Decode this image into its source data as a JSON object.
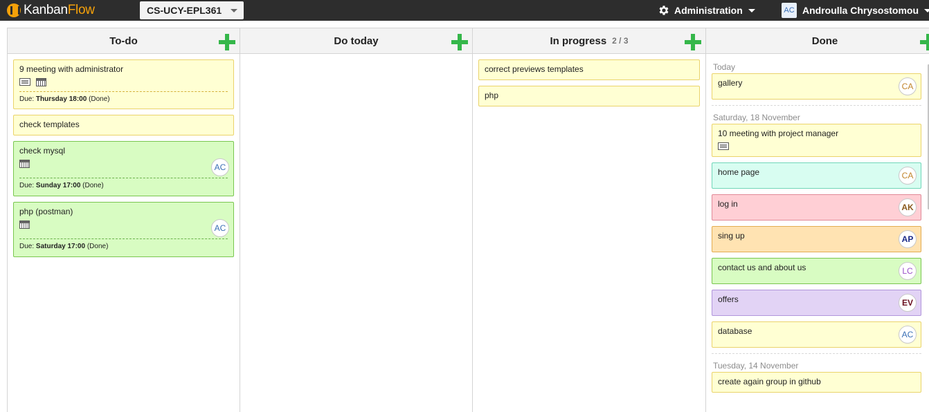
{
  "app": {
    "logo_a": "Kanban",
    "logo_b": "Flow",
    "board_name": "CS-UCY-EPL361",
    "admin_label": "Administration",
    "user_initials": "AC",
    "user_name": "Androulla Chrysostomou"
  },
  "columns": {
    "todo": {
      "title": "To-do",
      "tasks": [
        {
          "name": "9 meeting with administrator",
          "due_prefix": "Due:",
          "due_when": "Thursday 18:00",
          "due_status": "(Done)"
        },
        {
          "name": "check templates"
        },
        {
          "name": "check mysql",
          "avatar": "AC",
          "due_prefix": "Due:",
          "due_when": "Sunday 17:00",
          "due_status": "(Done)"
        },
        {
          "name": "php (postman)",
          "avatar": "AC",
          "due_prefix": "Due:",
          "due_when": "Saturday 17:00",
          "due_status": "(Done)"
        }
      ]
    },
    "do_today": {
      "title": "Do today"
    },
    "in_progress": {
      "title": "In progress",
      "wip": "2 / 3",
      "tasks": [
        {
          "name": "correct previews templates"
        },
        {
          "name": "php"
        }
      ]
    },
    "done": {
      "title": "Done",
      "groups": [
        {
          "label": "Today"
        },
        {
          "label": "Saturday, 18 November"
        },
        {
          "label": "Tuesday, 14 November"
        }
      ],
      "tasks": [
        {
          "name": "gallery",
          "avatar": "CA"
        },
        {
          "name": "10 meeting with project manager"
        },
        {
          "name": "home page",
          "avatar": "CA"
        },
        {
          "name": "log in",
          "avatar": "AK"
        },
        {
          "name": "sing up",
          "avatar": "AP"
        },
        {
          "name": "contact us and about us",
          "avatar": "LC"
        },
        {
          "name": "offers",
          "avatar": "EV"
        },
        {
          "name": "database",
          "avatar": "AC"
        },
        {
          "name": "create again group in github"
        }
      ]
    }
  },
  "colors": {
    "topbar": "#2d2d2d",
    "brand_orange": "#f5a10a",
    "add_green": "#35b74a",
    "card_yellow": "#ffffd3",
    "card_green": "#d8fcc2",
    "card_teal": "#d8fdf1",
    "card_pink": "#ffcfd5",
    "card_orange": "#ffe3b2",
    "card_purple": "#e2d3f5"
  },
  "icons": [
    "gear-icon",
    "dropdown-caret-icon",
    "add-task-icon",
    "description-icon",
    "calendar-icon"
  ]
}
